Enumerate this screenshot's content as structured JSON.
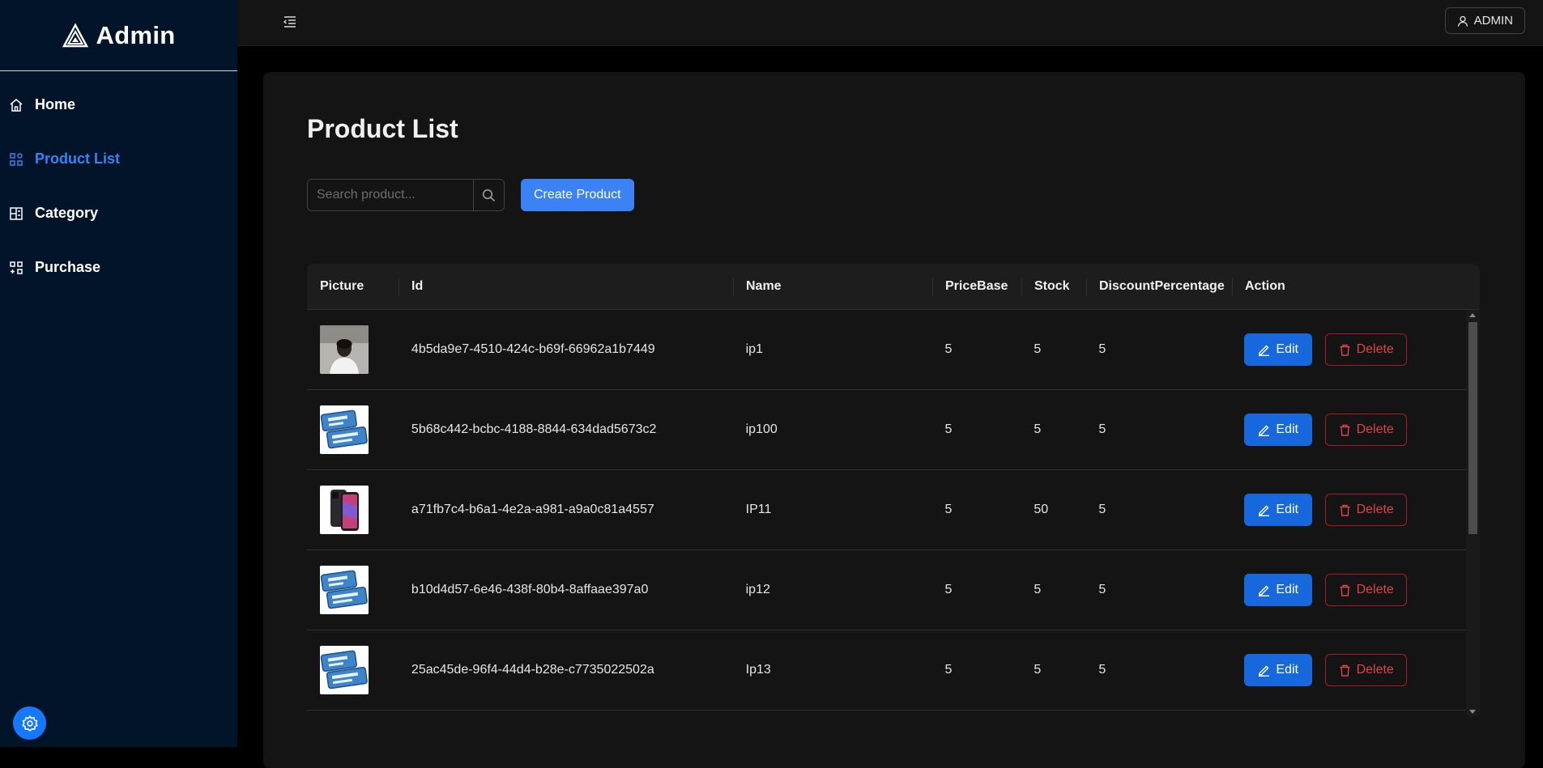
{
  "brand": {
    "name": "Admin"
  },
  "sidebar": {
    "items": [
      {
        "label": "Home",
        "icon": "home-icon",
        "active": false
      },
      {
        "label": "Product List",
        "icon": "product-list-icon",
        "active": true
      },
      {
        "label": "Category",
        "icon": "category-icon",
        "active": false
      },
      {
        "label": "Purchase",
        "icon": "purchase-icon",
        "active": false
      }
    ],
    "settings_icon": "gear-icon"
  },
  "header": {
    "user_label": "ADMIN",
    "menu_icon": "menu-fold-icon"
  },
  "page": {
    "title": "Product List",
    "search": {
      "placeholder": "Search product...",
      "value": ""
    },
    "create_label": "Create Product"
  },
  "table": {
    "columns": [
      "Picture",
      "Id",
      "Name",
      "PriceBase",
      "Stock",
      "DiscountPercentage",
      "Action"
    ],
    "edit_label": "Edit",
    "delete_label": "Delete",
    "rows": [
      {
        "picture": "person-photo",
        "id": "4b5da9e7-4510-424c-b69f-66962a1b7449",
        "name": "ip1",
        "price": "5",
        "stock": "5",
        "discount": "5"
      },
      {
        "picture": "new-product-badge",
        "id": "5b68c442-bcbc-4188-8844-634dad5673c2",
        "name": "ip100",
        "price": "5",
        "stock": "5",
        "discount": "5"
      },
      {
        "picture": "phone-photo",
        "id": "a71fb7c4-b6a1-4e2a-a981-a9a0c81a4557",
        "name": "IP11",
        "price": "5",
        "stock": "50",
        "discount": "5"
      },
      {
        "picture": "new-product-badge",
        "id": "b10d4d57-6e46-438f-80b4-8affaae397a0",
        "name": "ip12",
        "price": "5",
        "stock": "5",
        "discount": "5"
      },
      {
        "picture": "new-product-badge",
        "id": "25ac45de-96f4-44d4-b28e-c7735022502a",
        "name": "Ip13",
        "price": "5",
        "stock": "5",
        "discount": "5"
      }
    ]
  },
  "colors": {
    "sidebar_bg": "#021429",
    "accent": "#3b82f6",
    "danger": "#dc4446"
  }
}
